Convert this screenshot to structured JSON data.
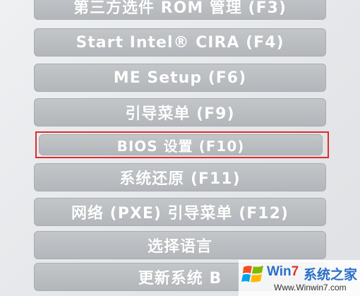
{
  "menu": {
    "items": [
      {
        "label": "第三方选件 ROM 管理 (F3)"
      },
      {
        "label": "Start Intel® CIRA (F4)"
      },
      {
        "label": "ME Setup (F6)"
      },
      {
        "label": "引导菜单 (F9)"
      },
      {
        "label": "BIOS 设置 (F10)"
      },
      {
        "label": "系统还原 (F11)"
      },
      {
        "label": "网络 (PXE) 引导菜单 (F12)"
      },
      {
        "label": "选择语言"
      },
      {
        "label": "更新系统 B"
      }
    ],
    "highlight_color": "#e02b2b",
    "button_color": "#b8bbbf"
  },
  "watermark": {
    "brand_prefix": "Win",
    "brand_seven": "7",
    "brand_cn": "系统之家",
    "url": "Www.Winwin7.com"
  }
}
